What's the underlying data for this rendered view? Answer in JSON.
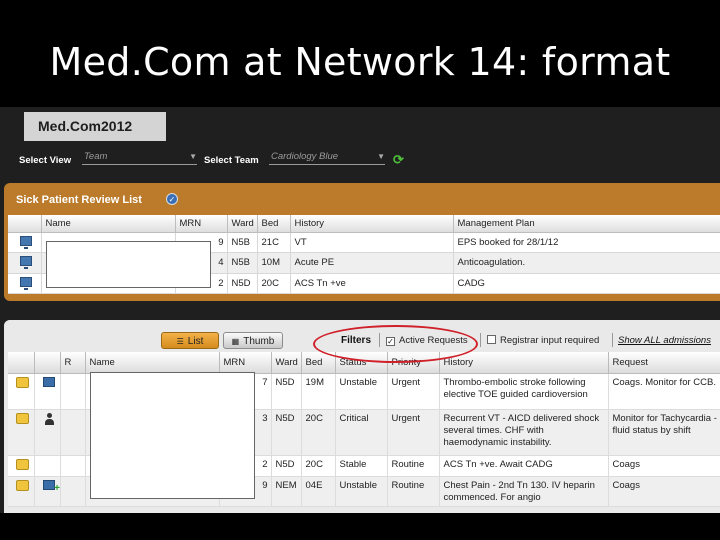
{
  "slide": {
    "title": "Med.Com at Network 14: format"
  },
  "app": {
    "logo": "Med.Com2012",
    "select_view_label": "Select View",
    "select_view_value": "Team",
    "select_team_label": "Select Team",
    "select_team_value": "Cardiology Blue"
  },
  "sick_list": {
    "title": "Sick Patient Review List",
    "columns": [
      "",
      "Name",
      "MRN",
      "Ward",
      "Bed",
      "History",
      "Management Plan"
    ],
    "rows": [
      {
        "mrn": "9",
        "ward": "N5B",
        "bed": "21C",
        "history": "VT",
        "plan": "EPS booked for 28/1/12"
      },
      {
        "mrn": "4",
        "ward": "N5B",
        "bed": "10M",
        "history": "Acute PE",
        "plan": "Anticoagulation."
      },
      {
        "mrn": "2",
        "ward": "N5D",
        "bed": "20C",
        "history": "ACS Tn +ve",
        "plan": "CADG"
      }
    ]
  },
  "admissions": {
    "list_button": "List",
    "thumb_button": "Thumb",
    "filters_label": "Filters",
    "active_requests_label": "Active Requests",
    "active_requests_checked": true,
    "registrar_label": "Registrar input required",
    "registrar_checked": false,
    "show_all_label": "Show ALL admissions",
    "columns": [
      "",
      "",
      "R",
      "Name",
      "MRN",
      "Ward",
      "Bed",
      "Status",
      "Priority",
      "History",
      "Request"
    ],
    "rows": [
      {
        "mrn": "7",
        "ward": "N5D",
        "bed": "19M",
        "status": "Unstable",
        "priority": "Urgent",
        "history": "Thrombo-embolic stroke following elective TOE guided cardioversion",
        "request": "Coags. Monitor for CCB."
      },
      {
        "mrn": "3",
        "ward": "N5D",
        "bed": "20C",
        "status": "Critical",
        "priority": "Urgent",
        "history": "Recurrent VT - AICD delivered shock several times. CHF with haemodynamic instability.",
        "request": "Monitor for Tachycardia - fluid status by shift"
      },
      {
        "mrn": "2",
        "ward": "N5D",
        "bed": "20C",
        "status": "Stable",
        "priority": "Routine",
        "history": "ACS Tn +ve. Await CADG",
        "request": "Coags"
      },
      {
        "mrn": "9",
        "ward": "NEM",
        "bed": "04E",
        "status": "Unstable",
        "priority": "Routine",
        "history": "Chest Pain - 2nd Tn 130. IV heparin commenced. For angio",
        "request": "Coags"
      }
    ]
  }
}
